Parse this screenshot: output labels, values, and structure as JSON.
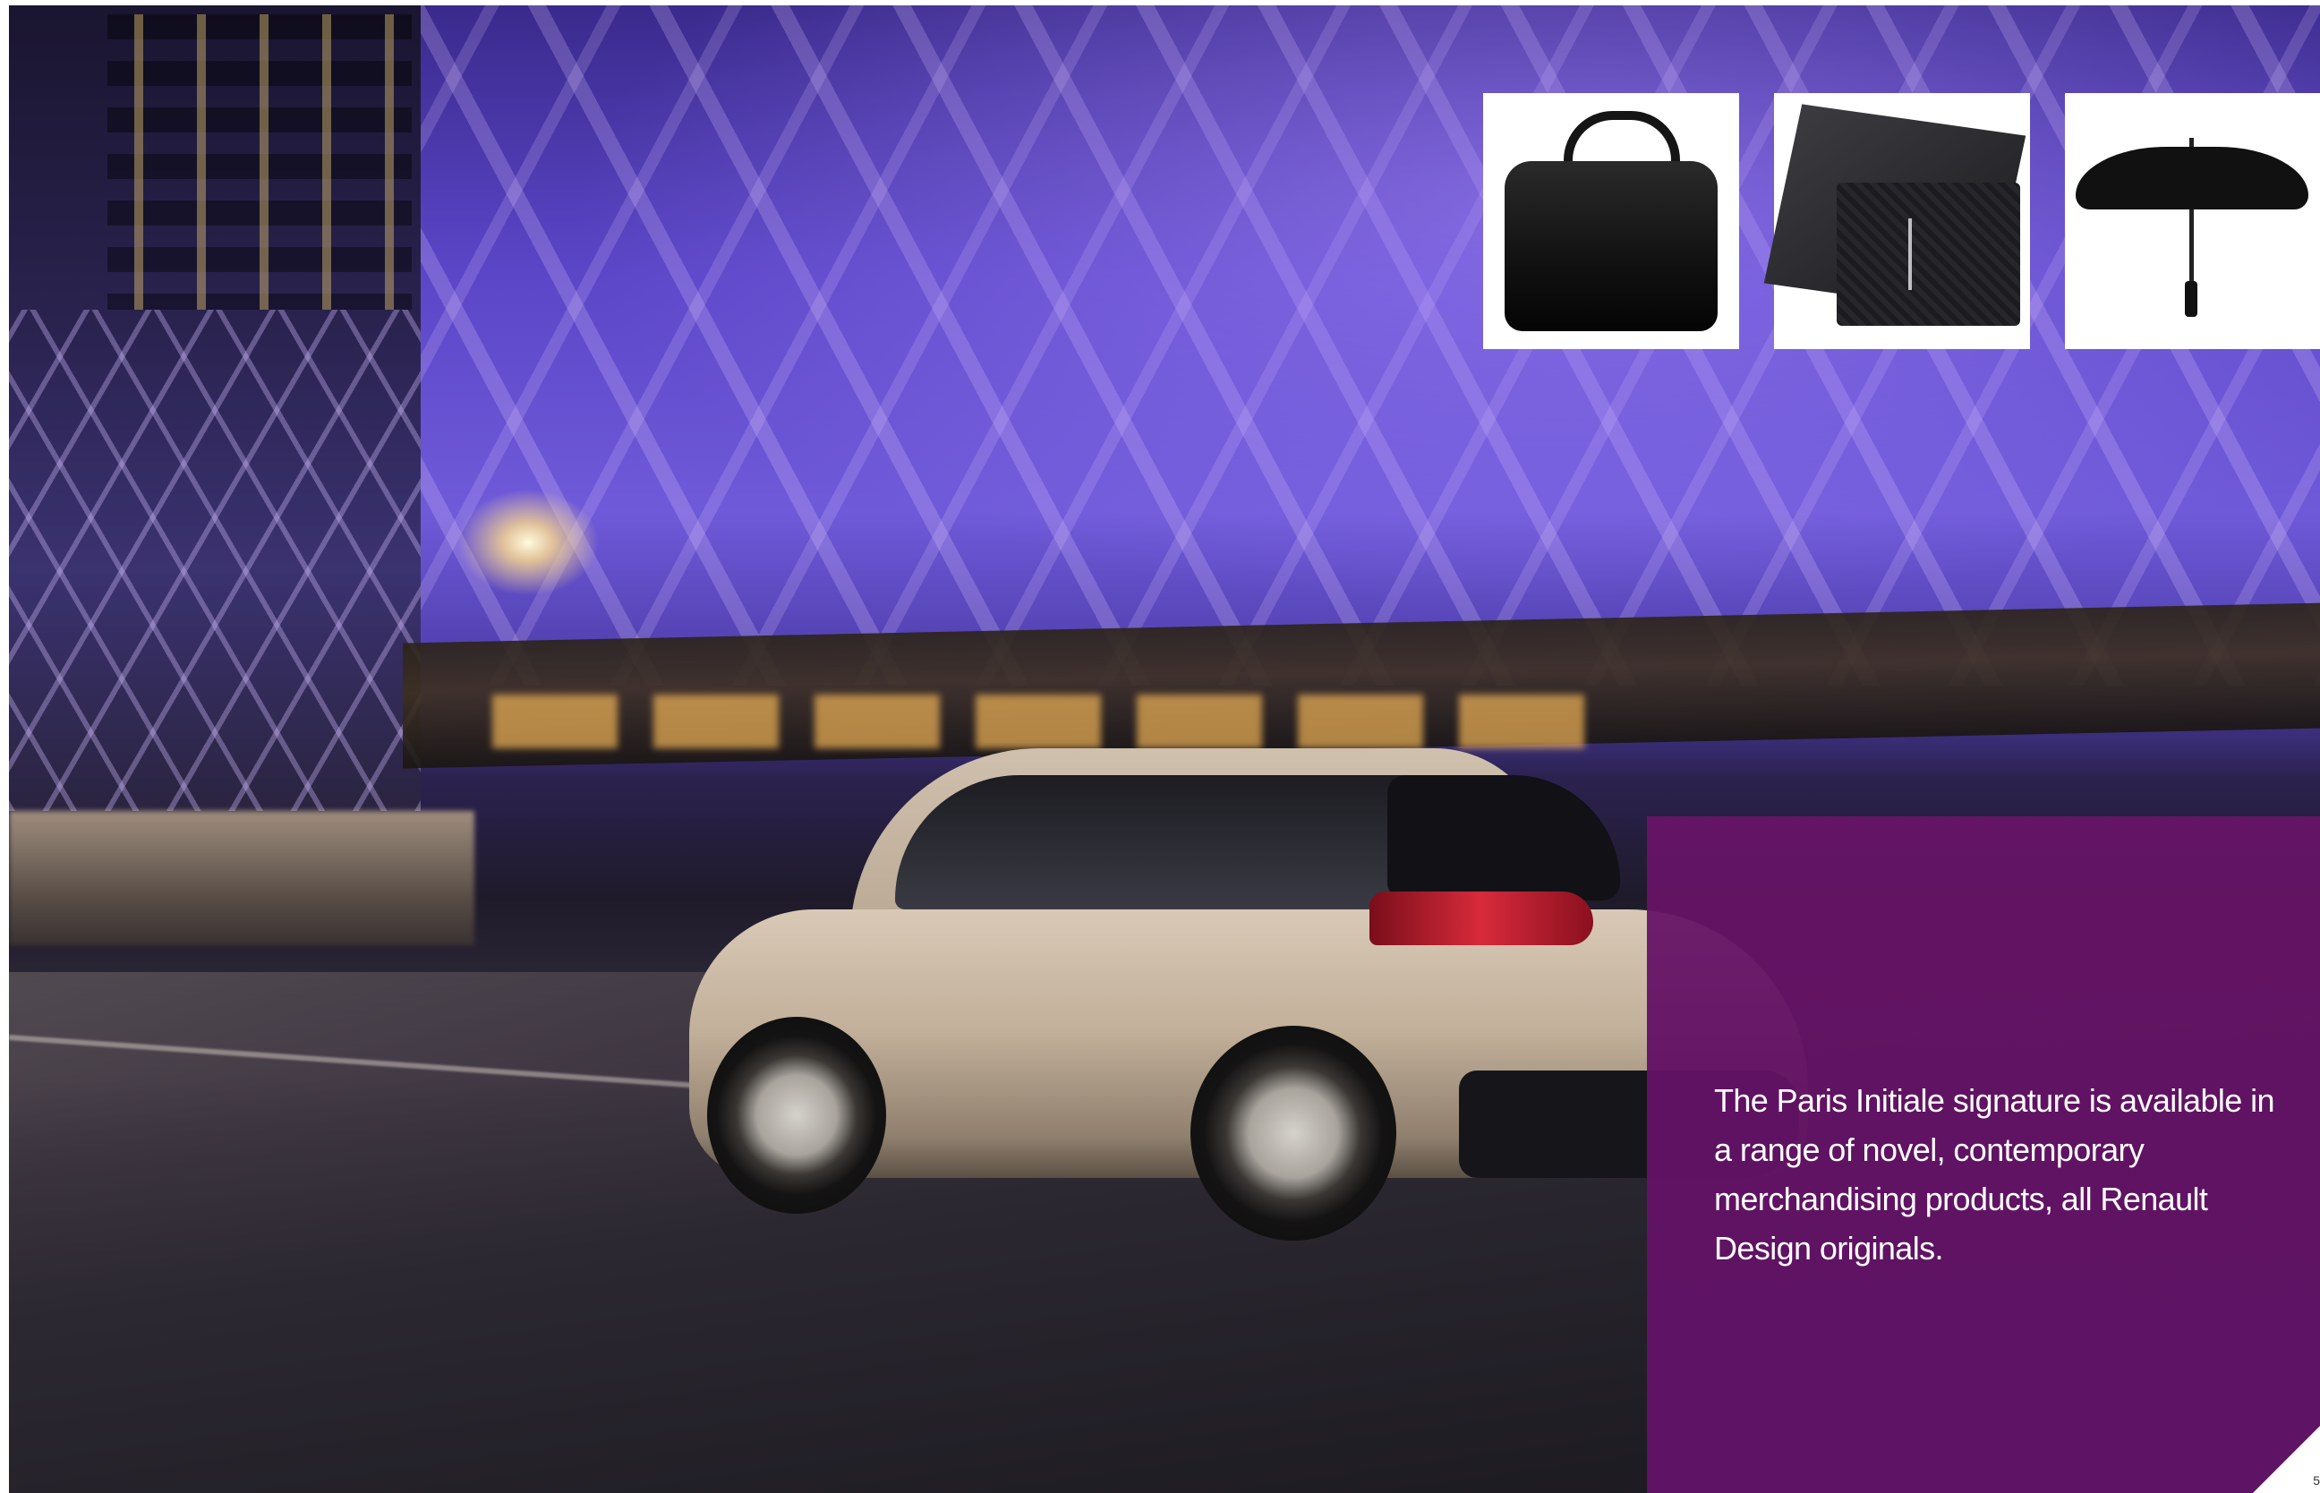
{
  "panel": {
    "text": "The Paris Initiale signature is available in a range of novel, contemporary merchandising products, all Renault Design originals.",
    "background_color": "#681468",
    "text_color": "#ffffff"
  },
  "products": [
    {
      "name": "bag-icon"
    },
    {
      "name": "wallet-icon"
    },
    {
      "name": "umbrella-icon"
    }
  ],
  "page": {
    "number": "5"
  }
}
